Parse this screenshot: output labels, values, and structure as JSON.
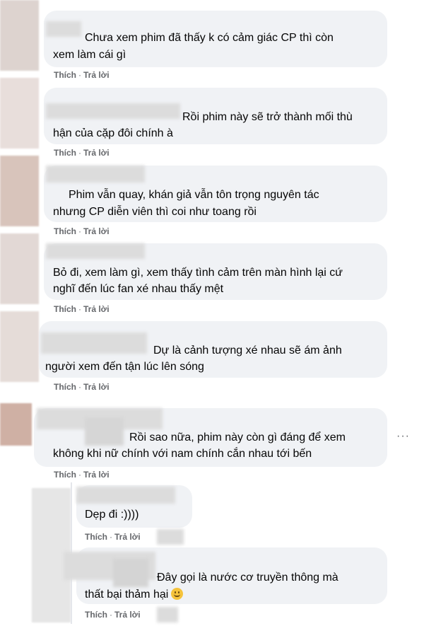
{
  "comments": [
    {
      "text_lines": [
        "Chưa xem phim đã thấy k có cảm giác CP thì còn",
        "xem làm cái gì"
      ],
      "like": "Thích",
      "reply": "Trả lời"
    },
    {
      "text_lines": [
        "Rồi phim này sẽ trở thành mối thù",
        "hận của cặp đôi chính à"
      ],
      "like": "Thích",
      "reply": "Trả lời"
    },
    {
      "text_lines": [
        "Phim vẫn quay, khán giả vẫn tôn trọng nguyên tác",
        "nhưng CP diễn viên thì coi như toang rồi"
      ],
      "like": "Thích",
      "reply": "Trả lời"
    },
    {
      "text_lines": [
        "Bỏ đi, xem làm gì, xem thấy tình cảm trên màn hình lại cứ",
        "nghĩ đến lúc fan xé nhau thấy mệt"
      ],
      "like": "Thích",
      "reply": "Trả lời"
    },
    {
      "text_lines": [
        "Dự là cảnh tượng xé nhau sẽ ám ảnh",
        "người xem đến tận lúc lên sóng"
      ],
      "like": "Thích",
      "reply": "Trả lời"
    },
    {
      "text_lines": [
        "Rồi sao nữa, phim này còn gì đáng để xem",
        "không khi nữ chính với nam chính cắn nhau tới bến"
      ],
      "like": "Thích",
      "reply": "Trả lời",
      "more": "···"
    }
  ],
  "replies": [
    {
      "text_lines": [
        "Dẹp đi :))))"
      ],
      "like": "Thích",
      "reply": "Trả lời"
    },
    {
      "text_lines": [
        "Đây gọi là nước cơ truyền thông mà",
        "thất bại thảm hại"
      ],
      "emoji": "smile-emoji",
      "like": "Thích",
      "reply": "Trả lời"
    }
  ],
  "separator": "·"
}
